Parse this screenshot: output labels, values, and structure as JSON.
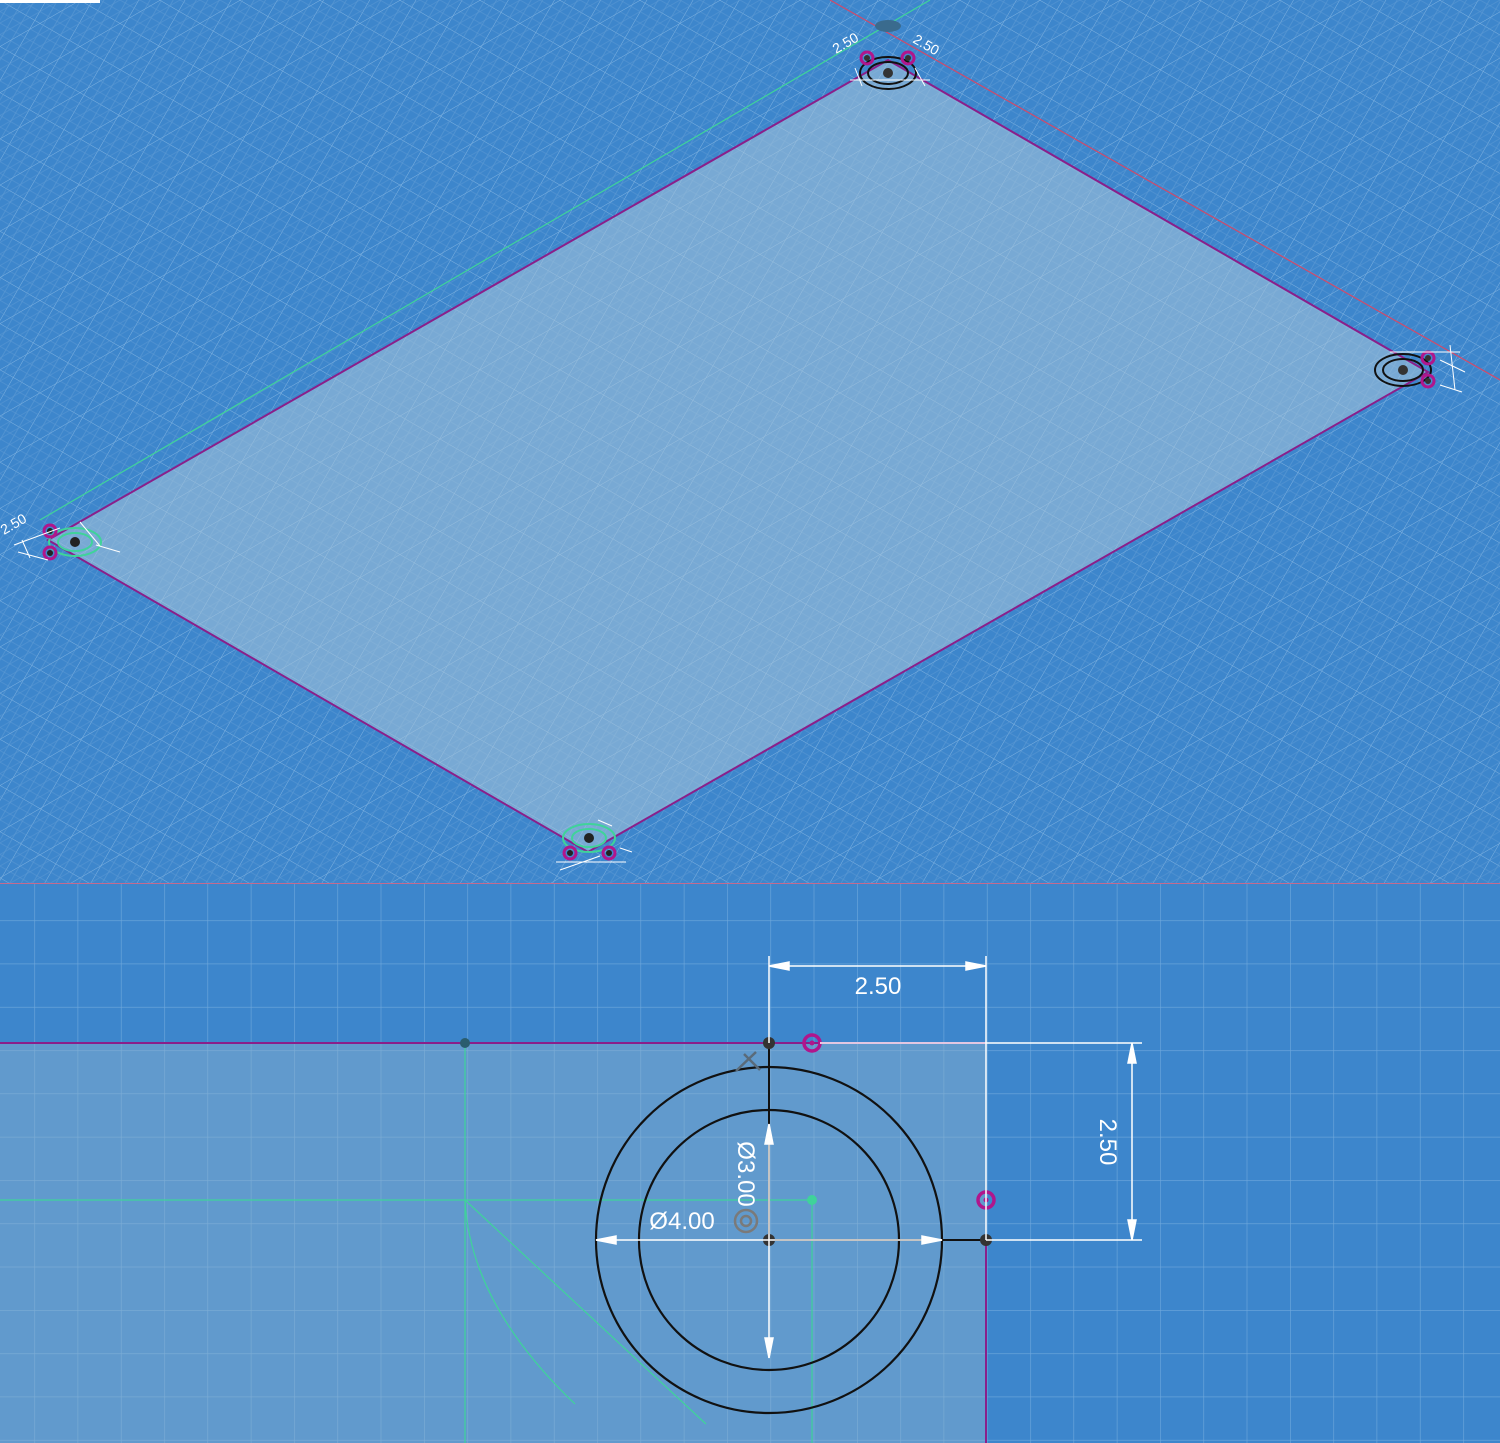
{
  "colors": {
    "viewport_background": "#3d86cc",
    "grid_line": "#7fb2e0",
    "sketch_plane_fill": "#8eb3cf",
    "profile_line": "#8a1f8a",
    "construction_line": "#3fd39a",
    "x_axis": "#d04a6a",
    "circle": "#111111",
    "dimension": "#ffffff",
    "constraint_point": "#b0168c"
  },
  "iso_view": {
    "corner_labels": {
      "top_dim_a": "2.50",
      "top_dim_b": "2.50",
      "left_dim": "2.50"
    }
  },
  "detail_view": {
    "dim_horizontal": "2.50",
    "dim_vertical": "2.50",
    "dim_inner_diameter": "Ø3.00",
    "dim_outer_diameter": "Ø4.00"
  }
}
